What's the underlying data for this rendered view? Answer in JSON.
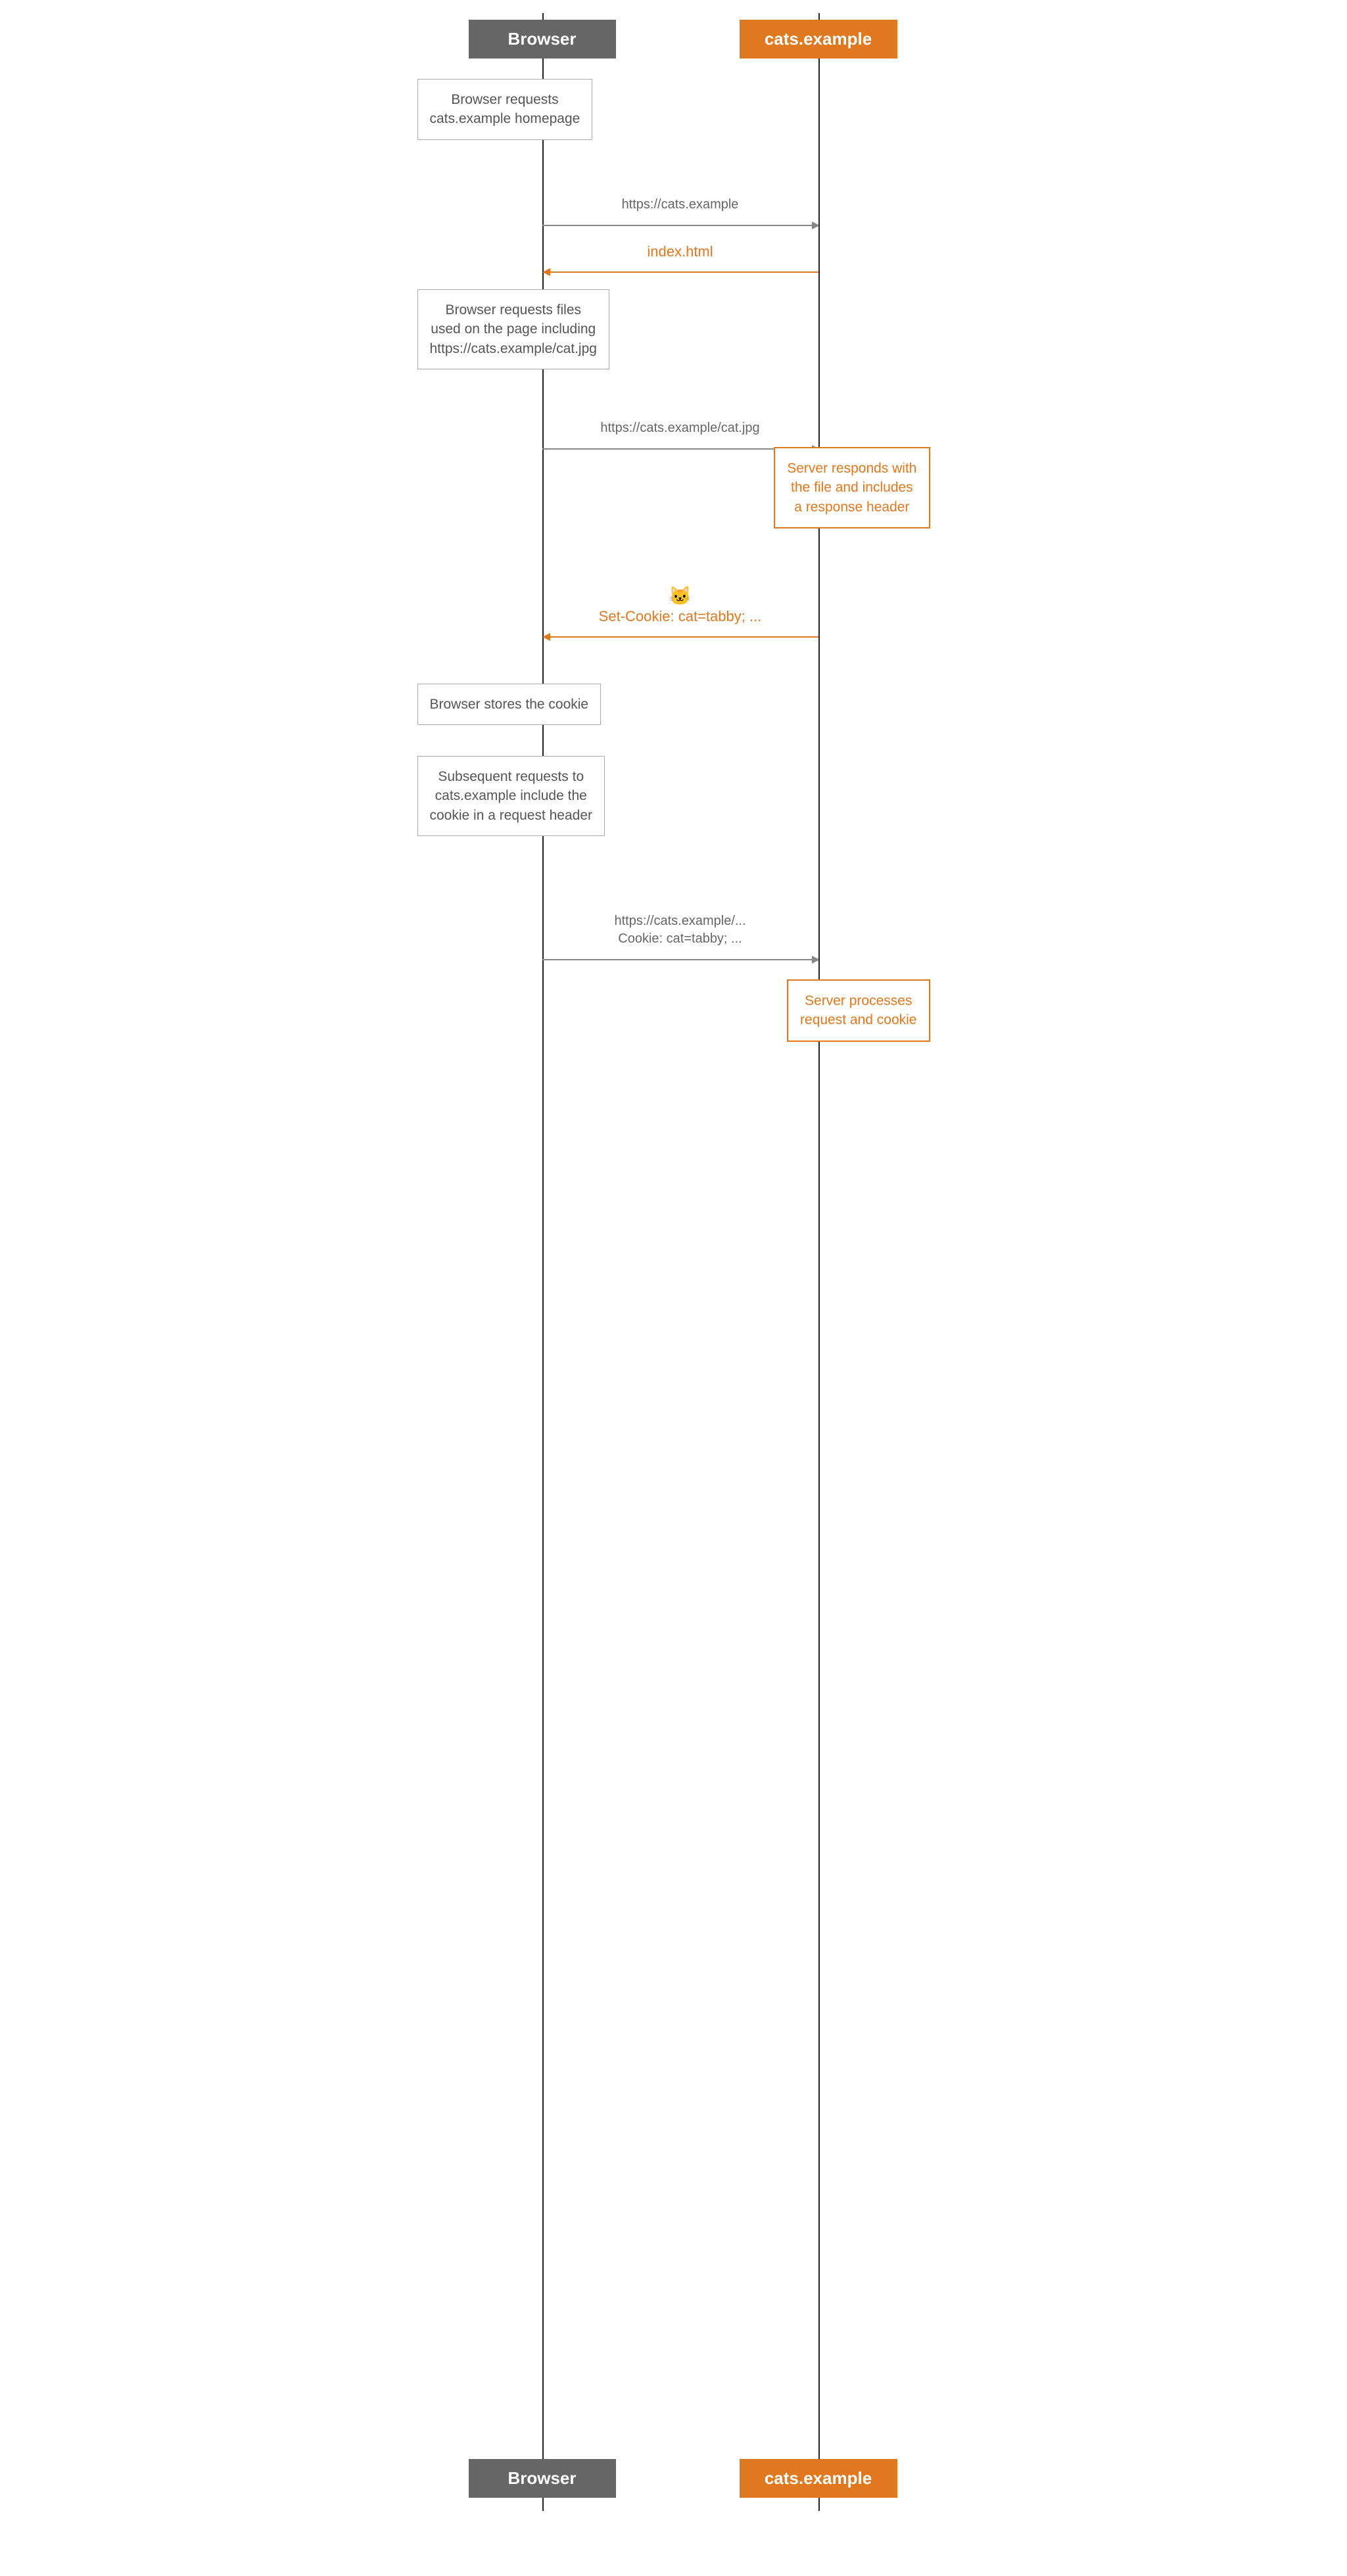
{
  "actors": {
    "browser_label": "Browser",
    "server_label": "cats.example"
  },
  "notes": {
    "browser_requests_homepage": "Browser requests\ncats.example homepage",
    "browser_requests_files": "Browser requests files\nused on the page including\nhttps://cats.example/cat.jpg",
    "server_responds_with_file": "Server responds with\nthe file and includes\na response header",
    "browser_stores_cookie": "Browser stores the cookie",
    "subsequent_requests": "Subsequent requests to\ncats.example include the\ncookie in a request header",
    "server_processes": "Server processes\nrequest and cookie"
  },
  "arrows": {
    "request_homepage": "https://cats.example",
    "response_index": "index.html",
    "request_cat_jpg": "https://cats.example/cat.jpg",
    "response_set_cookie_emoji": "🐱",
    "response_set_cookie": "Set-Cookie: cat=tabby; ...",
    "subsequent_request_line1": "https://cats.example/...",
    "subsequent_request_line2": "Cookie: cat=tabby; ..."
  },
  "colors": {
    "orange": "#E07820",
    "gray_actor": "#666666",
    "arrow_gray": "#888888",
    "border_gray": "#aaaaaa"
  }
}
